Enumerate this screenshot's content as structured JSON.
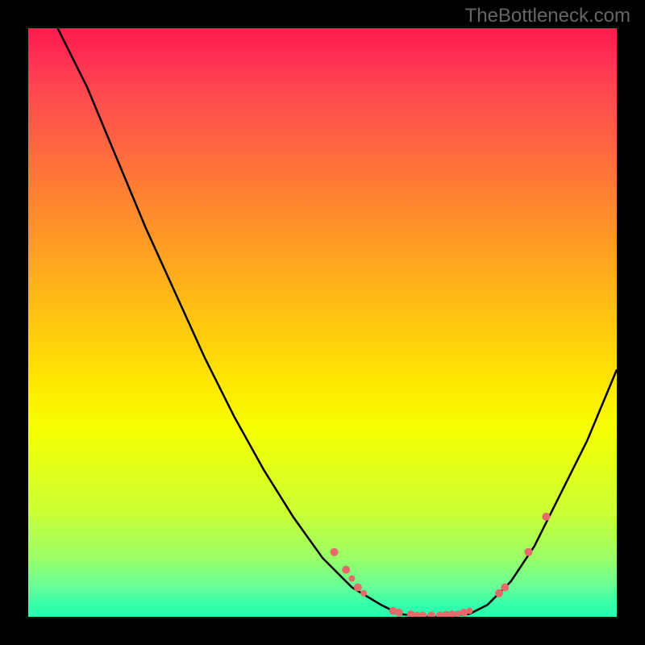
{
  "watermark": "TheBottleneck.com",
  "chart_data": {
    "type": "line",
    "title": "",
    "xlabel": "",
    "ylabel": "",
    "xlim": [
      0,
      100
    ],
    "ylim": [
      0,
      100
    ],
    "curve": [
      {
        "x": 5,
        "y": 100
      },
      {
        "x": 10,
        "y": 90
      },
      {
        "x": 15,
        "y": 78
      },
      {
        "x": 20,
        "y": 66
      },
      {
        "x": 25,
        "y": 55
      },
      {
        "x": 30,
        "y": 44
      },
      {
        "x": 35,
        "y": 34
      },
      {
        "x": 40,
        "y": 25
      },
      {
        "x": 45,
        "y": 17
      },
      {
        "x": 50,
        "y": 10
      },
      {
        "x": 55,
        "y": 5
      },
      {
        "x": 60,
        "y": 2
      },
      {
        "x": 63,
        "y": 0.5
      },
      {
        "x": 67,
        "y": 0
      },
      {
        "x": 71,
        "y": 0
      },
      {
        "x": 75,
        "y": 0.5
      },
      {
        "x": 78,
        "y": 2
      },
      {
        "x": 82,
        "y": 6
      },
      {
        "x": 86,
        "y": 12
      },
      {
        "x": 90,
        "y": 20
      },
      {
        "x": 95,
        "y": 30
      },
      {
        "x": 100,
        "y": 42
      }
    ],
    "markers": [
      {
        "x": 52,
        "y": 11,
        "r": 5
      },
      {
        "x": 54,
        "y": 8,
        "r": 5
      },
      {
        "x": 55,
        "y": 6.5,
        "r": 4
      },
      {
        "x": 56,
        "y": 5,
        "r": 5
      },
      {
        "x": 57,
        "y": 4,
        "r": 4
      },
      {
        "x": 62,
        "y": 1,
        "r": 5
      },
      {
        "x": 63,
        "y": 0.7,
        "r": 5
      },
      {
        "x": 65,
        "y": 0.4,
        "r": 5
      },
      {
        "x": 66,
        "y": 0.3,
        "r": 4
      },
      {
        "x": 67,
        "y": 0.2,
        "r": 5
      },
      {
        "x": 68.5,
        "y": 0.2,
        "r": 5
      },
      {
        "x": 70,
        "y": 0.2,
        "r": 5
      },
      {
        "x": 71,
        "y": 0.3,
        "r": 5
      },
      {
        "x": 72,
        "y": 0.4,
        "r": 5
      },
      {
        "x": 73,
        "y": 0.5,
        "r": 4
      },
      {
        "x": 74,
        "y": 0.7,
        "r": 5
      },
      {
        "x": 75,
        "y": 1,
        "r": 4
      },
      {
        "x": 80,
        "y": 4,
        "r": 5
      },
      {
        "x": 81,
        "y": 5,
        "r": 5
      },
      {
        "x": 85,
        "y": 11,
        "r": 5
      },
      {
        "x": 88,
        "y": 17,
        "r": 5
      }
    ],
    "marker_color": "#e66a6a",
    "curve_color": "#000000"
  }
}
